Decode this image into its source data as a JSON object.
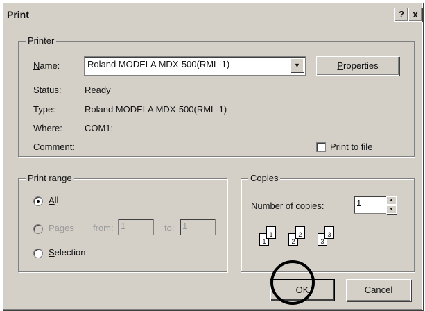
{
  "window": {
    "title": "Print",
    "help_btn": "?",
    "close_btn": "x"
  },
  "printer": {
    "group_label": "Printer",
    "name_label": "Name:",
    "name_value": "Roland MODELA MDX-500(RML-1)",
    "properties_label": "Properties",
    "status_label": "Status:",
    "status_value": "Ready",
    "type_label": "Type:",
    "type_value": "Roland MODELA MDX-500(RML-1)",
    "where_label": "Where:",
    "where_value": "COM1:",
    "comment_label": "Comment:",
    "print_to_file_label": "Print to file",
    "print_to_file_checked": false
  },
  "print_range": {
    "group_label": "Print range",
    "all_label": "All",
    "pages_label": "Pages",
    "from_label": "from:",
    "from_value": "1",
    "to_label": "to:",
    "to_value": "1",
    "selection_label": "Selection",
    "selected": "all"
  },
  "copies": {
    "group_label": "Copies",
    "number_label": "Number of copies:",
    "number_value": "1",
    "collate_digits": [
      "1",
      "1",
      "2",
      "2",
      "3",
      "3"
    ]
  },
  "buttons": {
    "ok_label": "OK",
    "cancel_label": "Cancel"
  }
}
